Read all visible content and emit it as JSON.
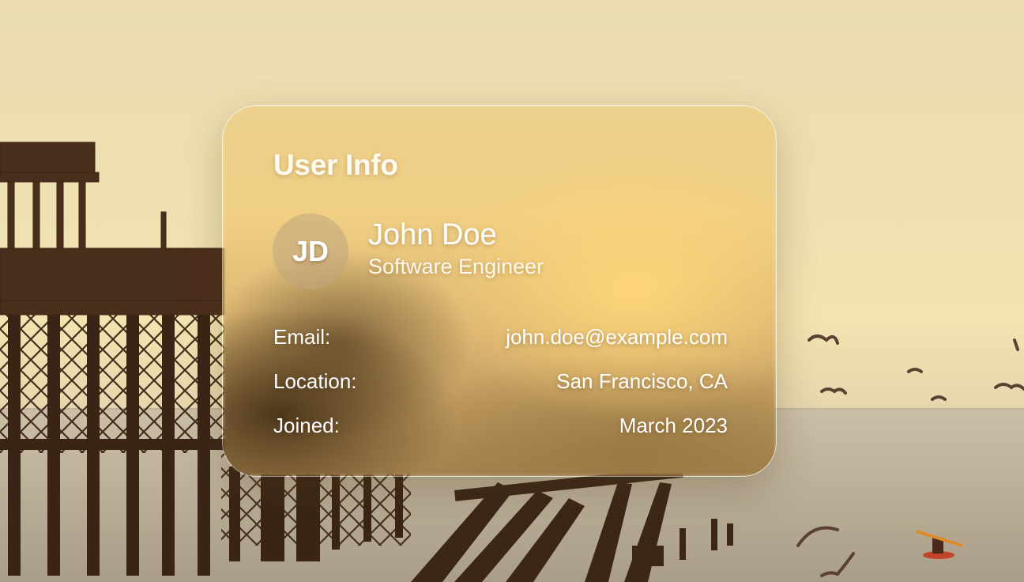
{
  "card": {
    "title": "User Info",
    "avatar_initials": "JD",
    "name": "John Doe",
    "role": "Software Engineer",
    "fields": [
      {
        "label": "Email:",
        "value": "john.doe@example.com"
      },
      {
        "label": "Location:",
        "value": "San Francisco, CA"
      },
      {
        "label": "Joined:",
        "value": "March 2023"
      }
    ]
  },
  "icons": [
    "photo-background"
  ],
  "colors": {
    "card_text": "#ffffff",
    "card_glass": "#ecd08c"
  }
}
